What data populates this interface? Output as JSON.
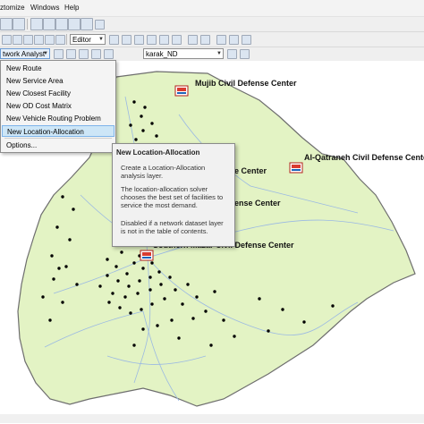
{
  "menubar": {
    "items": [
      "ztomize",
      "Windows",
      "Help"
    ]
  },
  "toolbar": {
    "editor_label": "Editor",
    "network_analyst_label": "twork Analyst",
    "network_dataset": "karak_ND"
  },
  "na_menu": {
    "items": [
      "New Route",
      "New Service Area",
      "New Closest Facility",
      "New OD Cost Matrix",
      "New Vehicle Routing Problem",
      "New Location-Allocation",
      "Options..."
    ],
    "highlighted_index": 5
  },
  "tooltip": {
    "title": "New Location-Allocation",
    "paragraphs": [
      "Create a Location-Allocation analysis layer.",
      "The location-allocation solver chooses the best set of facilities to service the most demand.",
      "Disabled if a network dataset layer is not in the table of contents."
    ]
  },
  "map": {
    "labels": [
      "Mujib Civil Defense Center",
      "Al-Qatraneh Civil Defense Cente",
      "e Center",
      "ense Center",
      "Southern Mazar Civil Defense Center"
    ],
    "region_fill": "#e3f3c4",
    "boundary_color": "#6e6e6e",
    "road_color": "#9bb9e3",
    "demand_point_color": "#000000",
    "facility_icon": "fire-station-icon"
  }
}
